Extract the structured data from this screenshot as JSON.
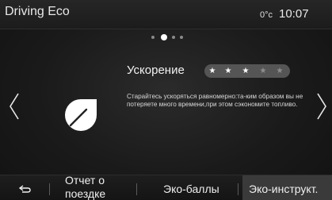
{
  "header": {
    "title": "Driving Eco",
    "temperature": "0°c",
    "time": "10:07"
  },
  "pager": {
    "count": 4,
    "active_index": 1
  },
  "card": {
    "metric_label": "Ускорение",
    "rating": {
      "filled": 3,
      "max": 5
    },
    "tip": "Старайтесь ускоряться равномерно:та-ким образом вы не потеряете много времени,при этом сэкономите топливо.",
    "icon": "leaf-icon"
  },
  "nav": {
    "prev_icon": "chevron-left-icon",
    "next_icon": "chevron-right-icon"
  },
  "footer": {
    "back_icon": "back-arrow-icon",
    "report_label": "Отчет о поездке",
    "scores_label": "Эко-баллы",
    "instructor_label": "Эко-инструкт."
  }
}
